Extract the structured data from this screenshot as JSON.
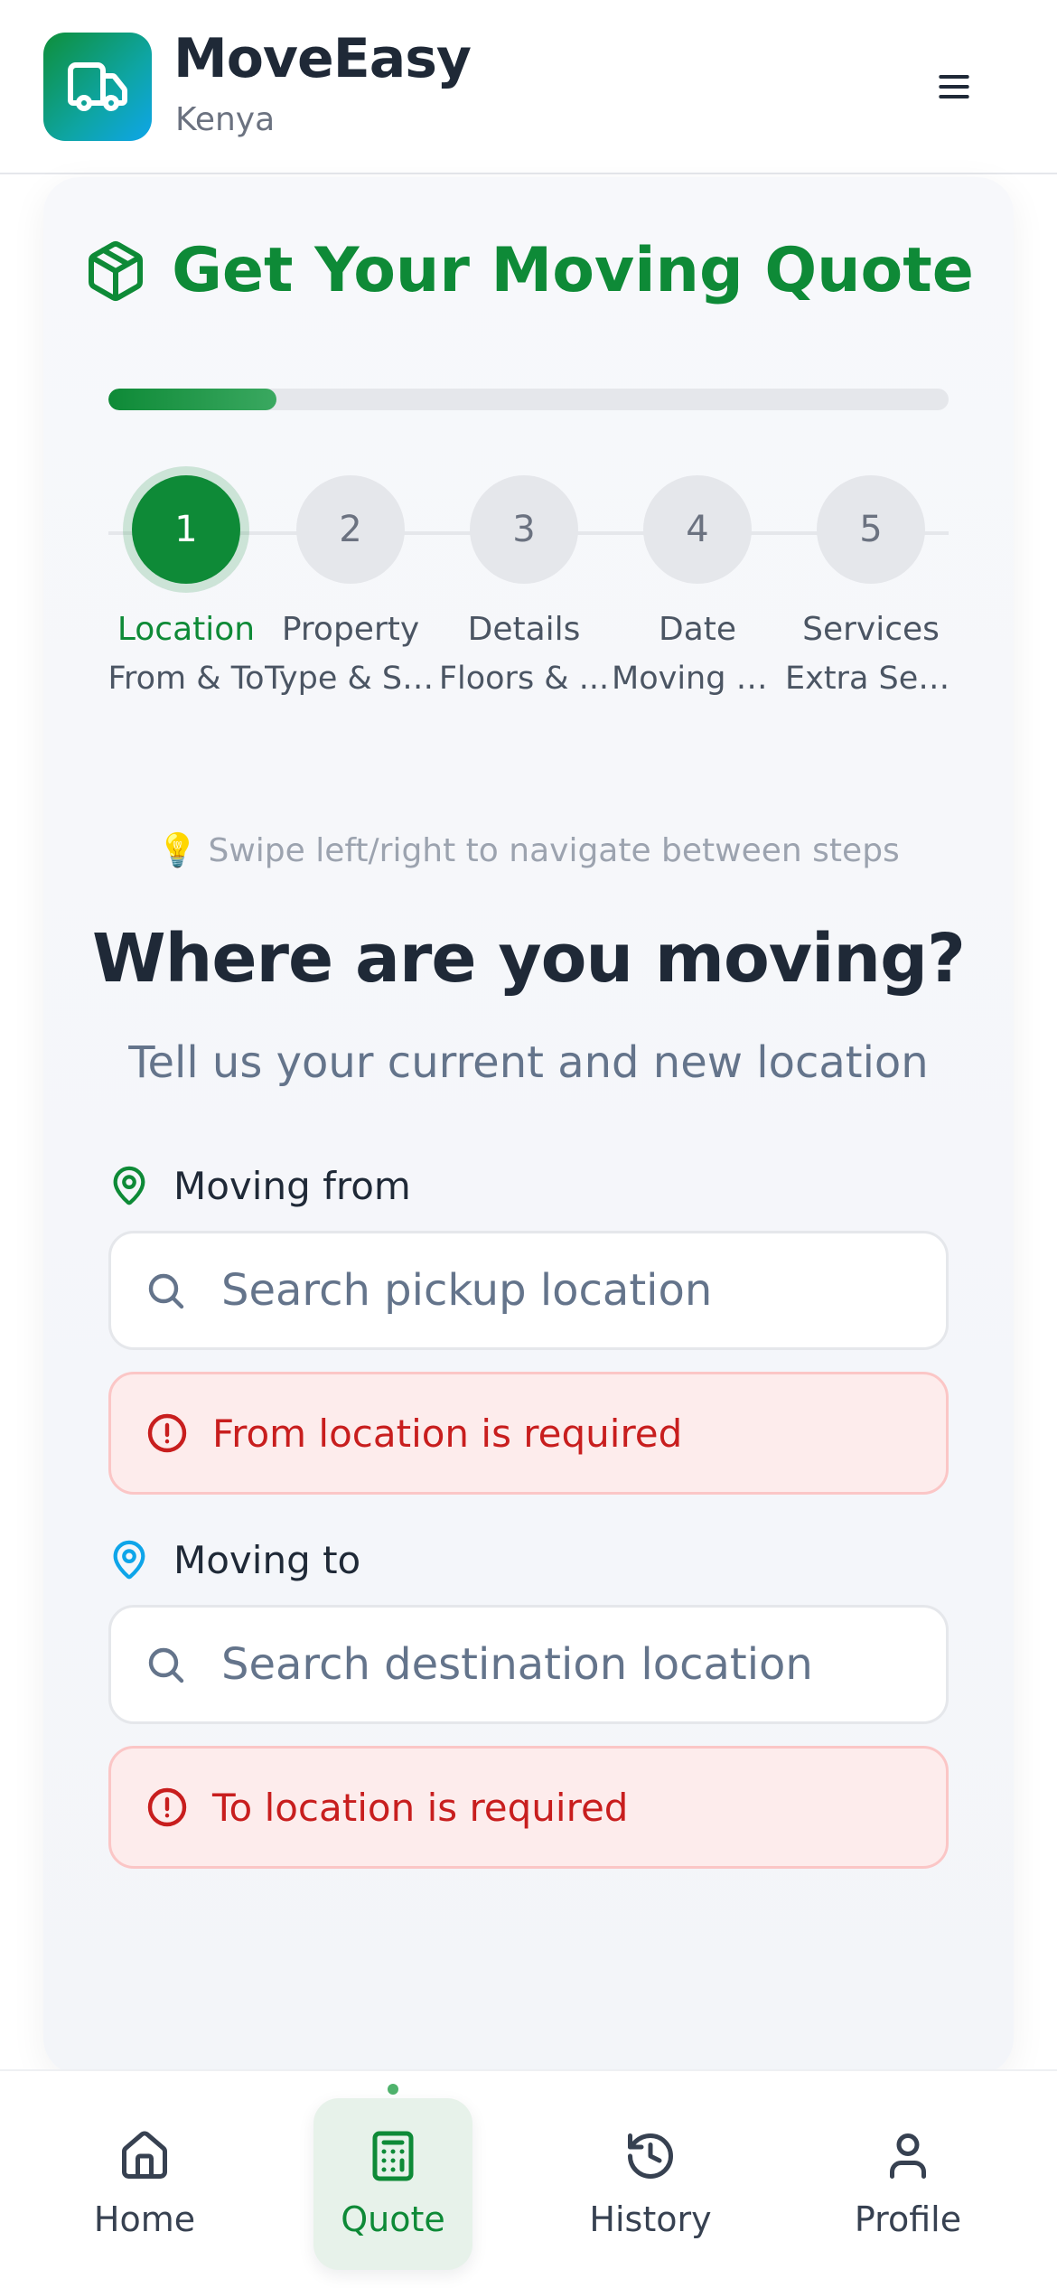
{
  "colors": {
    "brand_green": "#0e8a37",
    "accent_blue": "#0ea5e9",
    "error_red": "#c81e1e",
    "error_bg": "#fdecec",
    "muted": "#64748b"
  },
  "header": {
    "app_name": "MoveEasy",
    "region": "Kenya",
    "logo_icon": "truck-icon",
    "menu_icon": "menu-icon"
  },
  "quote": {
    "title": "Get Your Moving Quote",
    "title_icon": "package-icon",
    "progress_fraction": 0.2
  },
  "steps": [
    {
      "number": "1",
      "label": "Location",
      "sub": "From & To",
      "active": true
    },
    {
      "number": "2",
      "label": "Property",
      "sub": "Type & Size",
      "active": false
    },
    {
      "number": "3",
      "label": "Details",
      "sub": "Floors & ...",
      "active": false
    },
    {
      "number": "4",
      "label": "Date",
      "sub": "Moving D...",
      "active": false
    },
    {
      "number": "5",
      "label": "Services",
      "sub": "Extra Ser...",
      "active": false
    }
  ],
  "hint": {
    "icon": "lightbulb-icon",
    "text": "Swipe left/right to navigate between steps"
  },
  "form": {
    "title": "Where are you moving?",
    "subtitle": "Tell us your current and new location",
    "from": {
      "label": "Moving from",
      "placeholder": "Search pickup location",
      "error": "From location is required"
    },
    "to": {
      "label": "Moving to",
      "placeholder": "Search destination location",
      "error": "To location is required"
    }
  },
  "nav": {
    "items": [
      {
        "label": "Home",
        "icon": "home-icon",
        "active": false
      },
      {
        "label": "Quote",
        "icon": "calculator-icon",
        "active": true
      },
      {
        "label": "History",
        "icon": "history-icon",
        "active": false
      },
      {
        "label": "Profile",
        "icon": "user-icon",
        "active": false
      }
    ]
  }
}
